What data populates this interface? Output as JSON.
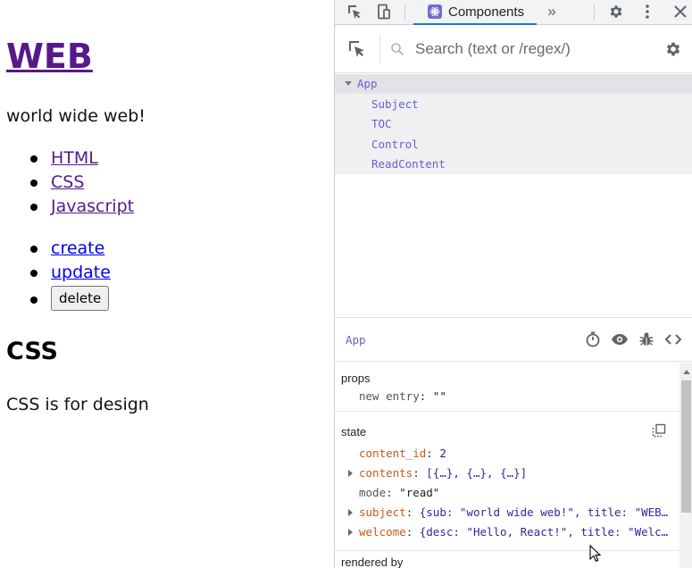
{
  "page": {
    "title": "WEB",
    "tagline": "world wide web!",
    "nav": [
      "HTML",
      "CSS",
      "Javascript"
    ],
    "controls": {
      "create": "create",
      "update": "update",
      "delete": "delete"
    },
    "article": {
      "title": "CSS",
      "desc": "CSS is for design"
    }
  },
  "devtools": {
    "tab_label": "Components",
    "search_placeholder": "Search (text or /regex/)",
    "tree": {
      "root": "App",
      "children": [
        "Subject",
        "TOC",
        "Control",
        "ReadContent"
      ]
    },
    "selected_component": "App",
    "props": {
      "title": "props",
      "entry_key": "new entry",
      "entry_value": "\"\""
    },
    "state": {
      "title": "state",
      "rows": [
        {
          "key": "content_id",
          "value": "2"
        },
        {
          "key": "contents",
          "value": "[{…}, {…}, {…}]"
        },
        {
          "key": "mode",
          "value": "\"read\""
        },
        {
          "key": "subject",
          "value": "{sub: \"world wide web!\", title: \"WEB…"
        },
        {
          "key": "welcome",
          "value": "{desc: \"Hello, React!\", title: \"Welc…"
        }
      ]
    },
    "rendered_by": "rendered by"
  },
  "colors": {
    "visited_link": "#551a8b",
    "link": "#0000ee",
    "component_name": "#6b5fc8",
    "state_key": "#c95b16",
    "tab_underline": "#1a73e8"
  },
  "icons": {
    "toolbar": [
      "inspect-icon",
      "device-toggle-icon",
      "more-tabs-icon",
      "gear-icon",
      "kebab-menu-icon",
      "close-icon"
    ],
    "detail": [
      "stopwatch-icon",
      "eye-icon",
      "bug-icon",
      "code-icon"
    ]
  }
}
